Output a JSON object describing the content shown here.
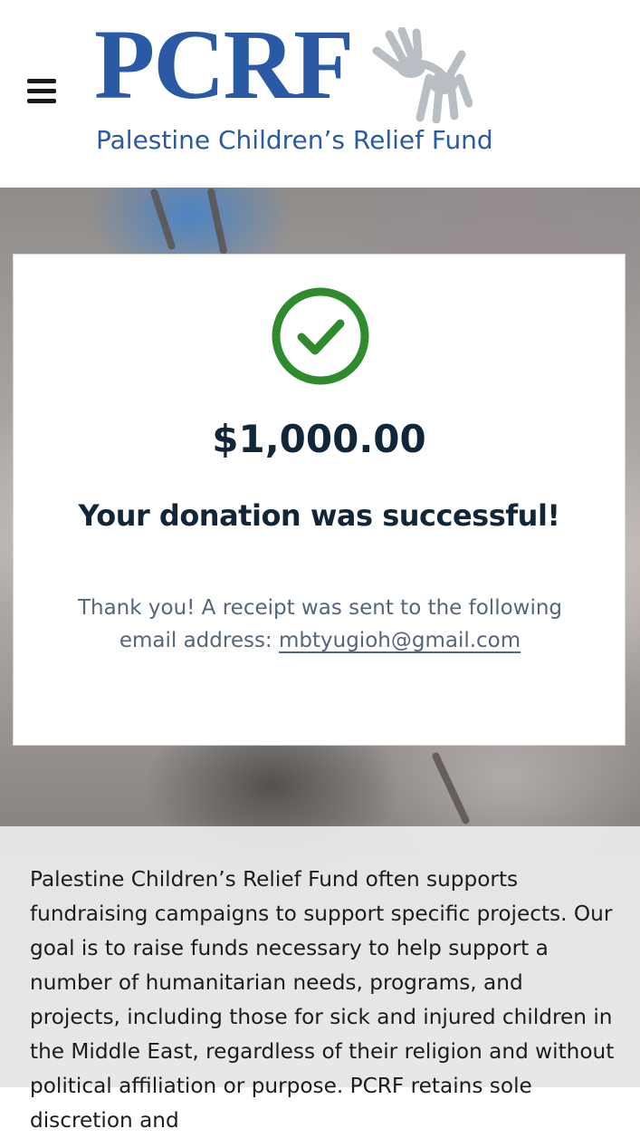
{
  "header": {
    "menu_icon": "hamburger-menu-icon",
    "logo": {
      "title": "PCRF",
      "subtitle": "Palestine Children’s Relief Fund",
      "hands_icon": "hands-icon",
      "color": "#2a5aa5"
    }
  },
  "card": {
    "status_icon": "check-circle-icon",
    "status_color": "#2e8b2e",
    "amount": "$1,000.00",
    "title": "Your donation was successful!",
    "receipt_text": "Thank you! A receipt was sent to the following email address:",
    "email": "mbtyugioh@gmail.com"
  },
  "description": {
    "text": "Palestine Children’s Relief Fund often supports fundraising campaigns to support specific projects. Our goal is to raise funds necessary to help support a number of humanitarian needs, programs, and projects, including those for sick and injured children in the Middle East, regardless of their religion and without political affiliation or purpose. PCRF retains sole discretion and"
  },
  "colors": {
    "heading": "#12263a",
    "muted_text": "#55657a",
    "brand_blue": "#2a5aa5"
  }
}
